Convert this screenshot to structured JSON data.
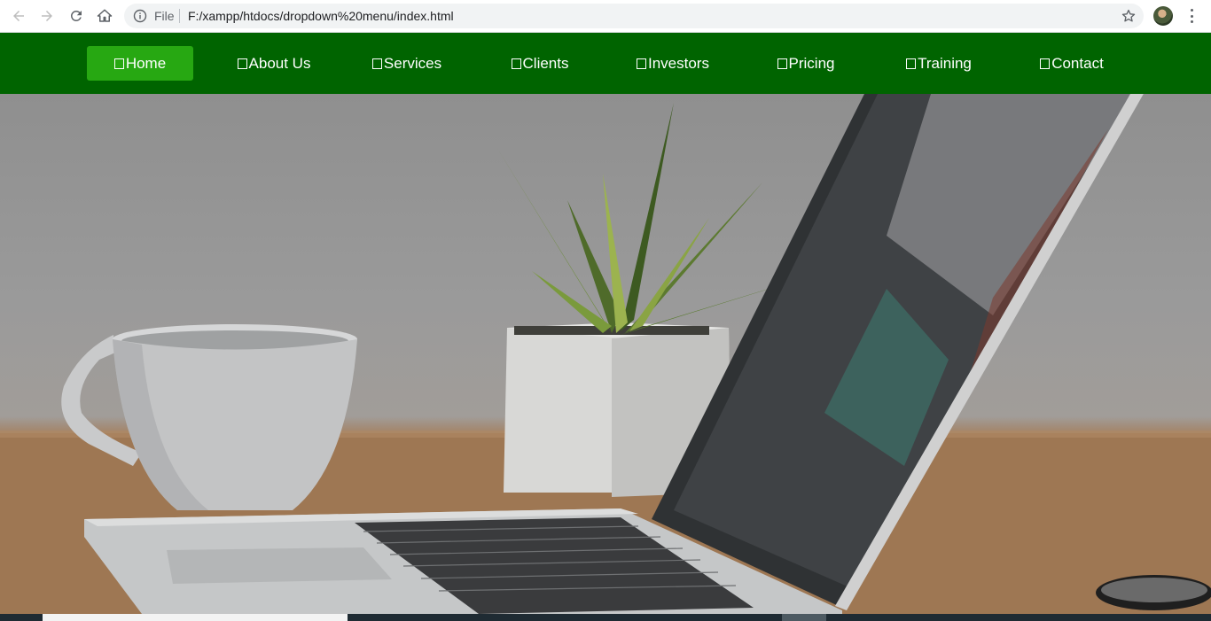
{
  "browser": {
    "back_icon": "arrow-left-icon",
    "forward_icon": "arrow-right-icon",
    "reload_icon": "reload-icon",
    "home_icon": "home-icon",
    "scheme_label": "File",
    "url": "F:/xampp/htdocs/dropdown%20menu/index.html",
    "bookmark_icon": "star-icon",
    "menu_icon": "kebab-icon"
  },
  "nav": {
    "background": "#006400",
    "active_background": "#27a812",
    "items": [
      {
        "label": "Home",
        "active": true
      },
      {
        "label": "About Us",
        "active": false
      },
      {
        "label": "Services",
        "active": false
      },
      {
        "label": "Clients",
        "active": false
      },
      {
        "label": "Investors",
        "active": false
      },
      {
        "label": "Pricing",
        "active": false
      },
      {
        "label": "Training",
        "active": false
      },
      {
        "label": "Contact",
        "active": false
      }
    ]
  }
}
